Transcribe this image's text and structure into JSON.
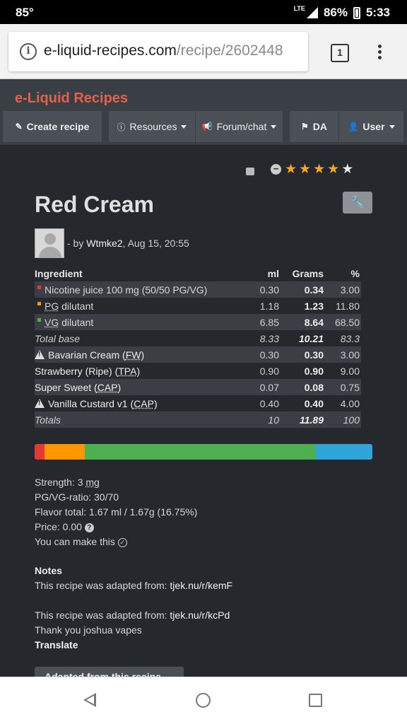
{
  "status_bar": {
    "temperature": "85°",
    "network": "LTE",
    "battery": "86%",
    "time": "5:33"
  },
  "browser": {
    "url_domain": "e-liquid-recipes.com",
    "url_path": "/recipe/2602448",
    "tab_count": "1"
  },
  "site": {
    "brand": "e-Liquid Recipes",
    "nav": {
      "create": "Create recipe",
      "resources": "Resources",
      "forum": "Forum/chat",
      "da": "DA",
      "user": "User"
    }
  },
  "recipe": {
    "title": "Red Cream",
    "rating": {
      "stars_filled": 4,
      "stars_total": 5
    },
    "by_prefix": "- by",
    "author": "Wtmke2",
    "date": ", Aug 15, 20:55"
  },
  "table": {
    "headers": {
      "ingredient": "Ingredient",
      "ml": "ml",
      "grams": "Grams",
      "percent": "%"
    },
    "base": [
      {
        "name": "Nicotine juice 100 mg (50/50 PG/VG)",
        "ml": "0.30",
        "grams": "0.34",
        "percent": "3.00",
        "color": "#e53935"
      },
      {
        "name_ul": "PG",
        "name_rest": " dilutant",
        "ml": "1.18",
        "grams": "1.23",
        "percent": "11.80",
        "color": "#ff9800"
      },
      {
        "name_ul": "VG",
        "name_rest": " dilutant",
        "ml": "6.85",
        "grams": "8.64",
        "percent": "68.50",
        "color": "#4caf50"
      }
    ],
    "total_base": {
      "label": "Total base",
      "ml": "8.33",
      "grams": "10.21",
      "percent": "83.3"
    },
    "flavors": [
      {
        "name": "Bavarian Cream (",
        "brand": "FW",
        "warning": true,
        "ml": "0.30",
        "grams": "0.30",
        "percent": "3.00"
      },
      {
        "name": "Strawberry (Ripe) (",
        "brand": "TPA",
        "warning": false,
        "ml": "0.90",
        "grams": "0.90",
        "percent": "9.00"
      },
      {
        "name": "Super Sweet (",
        "brand": "CAP",
        "warning": false,
        "ml": "0.07",
        "grams": "0.08",
        "percent": "0.75"
      },
      {
        "name": "Vanilla Custard v1 (",
        "brand": "CAP",
        "warning": true,
        "ml": "0.40",
        "grams": "0.40",
        "percent": "4.00"
      }
    ],
    "totals": {
      "label": "Totals",
      "ml": "10",
      "grams": "11.89",
      "percent": "100"
    }
  },
  "ratio_bar": [
    {
      "percent": 3.0,
      "color": "#e53935"
    },
    {
      "percent": 11.8,
      "color": "#ff9800"
    },
    {
      "percent": 68.5,
      "color": "#4caf50"
    },
    {
      "percent": 16.7,
      "color": "#2fa4d8"
    }
  ],
  "stats": {
    "strength_prefix": "Strength: 3 ",
    "strength_unit": "mg",
    "pgvg": "PG/VG-ratio: 30/70",
    "flavor_total": "Flavor total: 1.67 ml / 1.67g (16.75%)",
    "price": "Price: 0.00",
    "make": "You can make this"
  },
  "notes": {
    "heading": "Notes",
    "line1_prefix": "This recipe was adapted from: ",
    "line1_link": "tjek.nu/r/kemF",
    "line2_prefix": "This recipe was adapted from: ",
    "line2_link": "tjek.nu/r/kcPd",
    "line3": "Thank you joshua vapes",
    "translate": "Translate"
  },
  "adapted_button": "Adapted from this recipe"
}
